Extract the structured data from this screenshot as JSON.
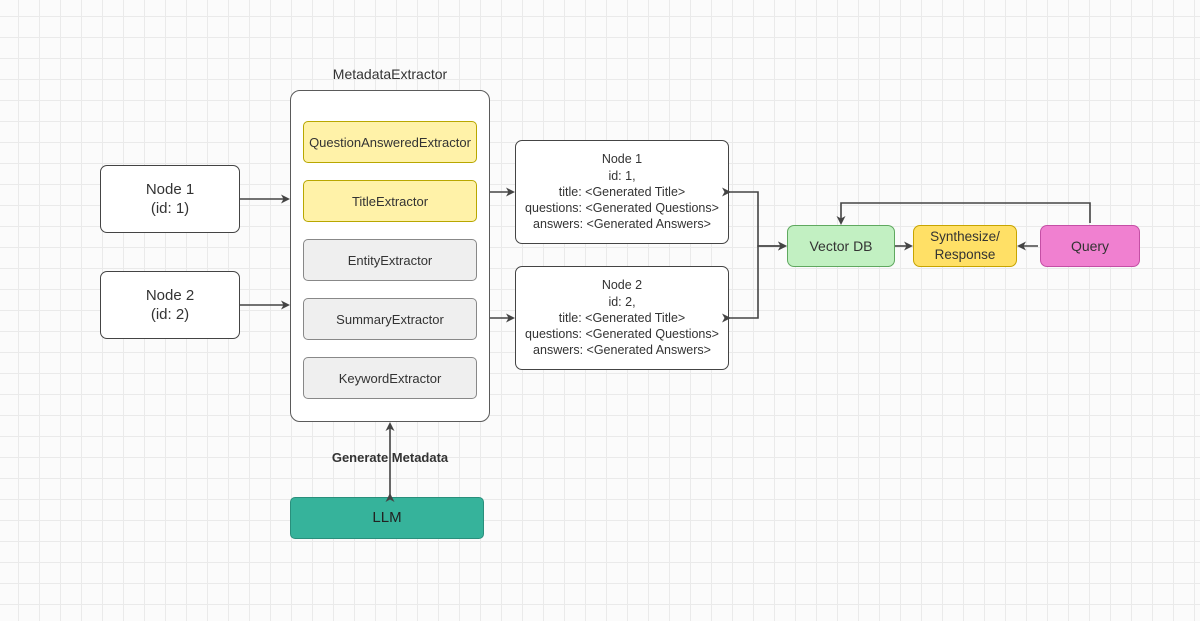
{
  "title": "MetadataExtractor",
  "input_nodes": [
    {
      "title": "Node 1",
      "id_line": "(id: 1)"
    },
    {
      "title": "Node 2",
      "id_line": "(id: 2)"
    }
  ],
  "extractors": [
    {
      "name": "QuestionAnsweredExtractor",
      "active": true
    },
    {
      "name": "TitleExtractor",
      "active": true
    },
    {
      "name": "EntityExtractor",
      "active": false
    },
    {
      "name": "SummaryExtractor",
      "active": false
    },
    {
      "name": "KeywordExtractor",
      "active": false
    }
  ],
  "generate_label": "Generate Metadata",
  "llm": "LLM",
  "output_nodes": [
    {
      "title": "Node 1",
      "id_line": "id: 1,",
      "title_line": "title: <Generated Title>",
      "questions_line": "questions: <Generated Questions>",
      "answers_line": "answers: <Generated Answers>"
    },
    {
      "title": "Node 2",
      "id_line": "id: 2,",
      "title_line": "title: <Generated Title>",
      "questions_line": "questions: <Generated Questions>",
      "answers_line": "answers: <Generated Answers>"
    }
  ],
  "vector_db": "Vector DB",
  "synth": {
    "line1": "Synthesize/",
    "line2": "Response"
  },
  "query": "Query",
  "colors": {
    "yellow": "#fff2a8",
    "grey": "#efefef",
    "teal": "#36b39b",
    "green": "#c2f0c2",
    "gold": "#ffe066",
    "magenta": "#f080d0"
  }
}
